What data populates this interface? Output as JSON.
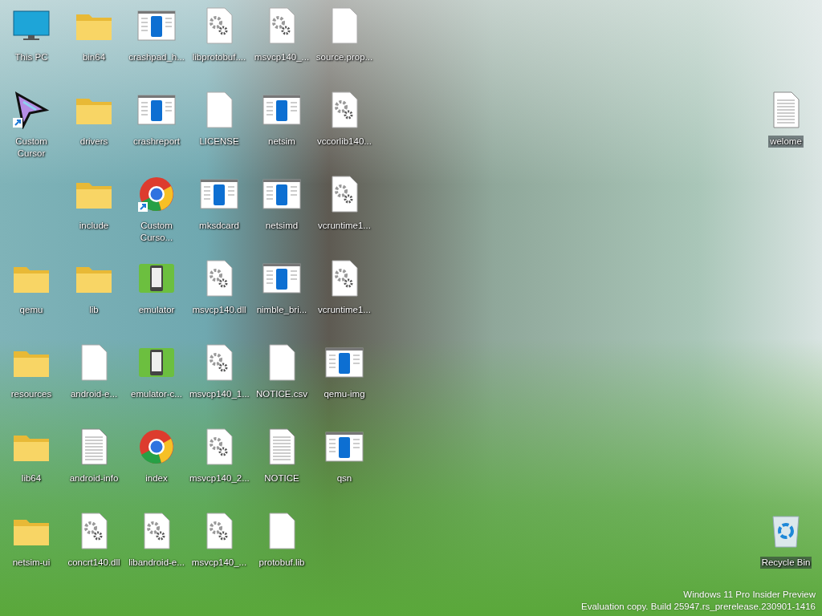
{
  "desktop": {
    "columns": [
      {
        "top_icons": [
          {
            "label": "This PC",
            "kind": "pc",
            "shortcut": false
          },
          {
            "label": "Custom Cursor",
            "kind": "cursor",
            "shortcut": true
          }
        ],
        "bottom_icons": [
          {
            "label": "qemu",
            "kind": "folder",
            "shortcut": false
          },
          {
            "label": "resources",
            "kind": "folder",
            "shortcut": false
          },
          {
            "label": "lib64",
            "kind": "folder",
            "shortcut": false
          },
          {
            "label": "netsim-ui",
            "kind": "folder",
            "shortcut": false
          }
        ]
      },
      {
        "top_icons": [
          {
            "label": "bin64",
            "kind": "folder",
            "shortcut": false
          },
          {
            "label": "drivers",
            "kind": "folder",
            "shortcut": false
          },
          {
            "label": "include",
            "kind": "folder",
            "shortcut": false
          },
          {
            "label": "lib",
            "kind": "folder",
            "shortcut": false
          },
          {
            "label": "android-e...",
            "kind": "blank",
            "shortcut": false
          },
          {
            "label": "android-info",
            "kind": "text",
            "shortcut": false
          },
          {
            "label": "concrt140.dll",
            "kind": "gears",
            "shortcut": false
          }
        ]
      },
      {
        "top_icons": [
          {
            "label": "crashpad_h...",
            "kind": "app",
            "shortcut": false
          },
          {
            "label": "crashreport",
            "kind": "app",
            "shortcut": false
          },
          {
            "label": "Custom Curso...",
            "kind": "browser",
            "shortcut": true
          },
          {
            "label": "emulator",
            "kind": "emulator",
            "shortcut": false
          },
          {
            "label": "emulator-c...",
            "kind": "emulator",
            "shortcut": false
          },
          {
            "label": "index",
            "kind": "browser",
            "shortcut": false
          },
          {
            "label": "libandroid-e...",
            "kind": "gears",
            "shortcut": false
          }
        ]
      },
      {
        "top_icons": [
          {
            "label": "libprotobuf....",
            "kind": "gears",
            "shortcut": false
          },
          {
            "label": "LICENSE",
            "kind": "blank",
            "shortcut": false
          },
          {
            "label": "mksdcard",
            "kind": "app",
            "shortcut": false
          },
          {
            "label": "msvcp140.dll",
            "kind": "gears",
            "shortcut": false
          },
          {
            "label": "msvcp140_1...",
            "kind": "gears",
            "shortcut": false
          },
          {
            "label": "msvcp140_2...",
            "kind": "gears",
            "shortcut": false
          },
          {
            "label": "msvcp140_...",
            "kind": "gears",
            "shortcut": false
          }
        ]
      },
      {
        "top_icons": [
          {
            "label": "msvcp140_...",
            "kind": "gears",
            "shortcut": false
          },
          {
            "label": "netsim",
            "kind": "app",
            "shortcut": false
          },
          {
            "label": "netsimd",
            "kind": "app",
            "shortcut": false
          },
          {
            "label": "nimble_bri...",
            "kind": "app",
            "shortcut": false
          },
          {
            "label": "NOTICE.csv",
            "kind": "blank",
            "shortcut": false
          },
          {
            "label": "NOTICE",
            "kind": "text",
            "shortcut": false
          },
          {
            "label": "protobuf.lib",
            "kind": "blank",
            "shortcut": false
          }
        ]
      },
      {
        "top_icons": [
          {
            "label": "source.prop...",
            "kind": "blank",
            "shortcut": false
          },
          {
            "label": "vccorlib140...",
            "kind": "gears",
            "shortcut": false
          },
          {
            "label": "vcruntime1...",
            "kind": "gears",
            "shortcut": false
          },
          {
            "label": "vcruntime1...",
            "kind": "gears",
            "shortcut": false
          },
          {
            "label": "qemu-img",
            "kind": "app",
            "shortcut": false
          },
          {
            "label": "qsn",
            "kind": "app",
            "shortcut": false
          }
        ]
      }
    ],
    "right_column": {
      "top_icons": [
        {
          "label": "welome",
          "kind": "text",
          "shortcut": false
        }
      ],
      "bottom_icons": [
        {
          "label": "Recycle Bin",
          "kind": "bin",
          "shortcut": false
        }
      ]
    }
  },
  "watermark_lines": [
    "Windows 11 Pro Insider Preview",
    "Evaluation copy. Build 25947.rs_prerelease.230901-1416"
  ]
}
